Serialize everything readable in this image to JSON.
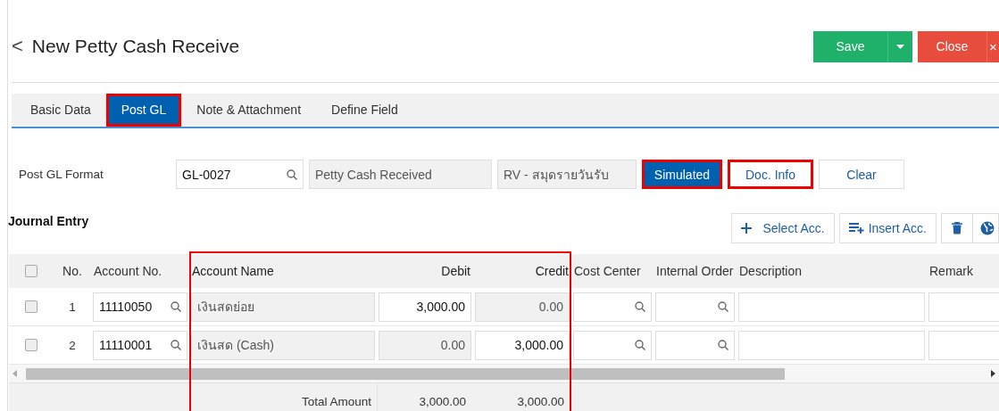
{
  "header": {
    "back": "<",
    "title": "New Petty Cash Receive",
    "save": "Save",
    "close": "Close",
    "close_x": "×"
  },
  "tabs": [
    {
      "label": "Basic Data",
      "selected": false,
      "highlighted": false
    },
    {
      "label": "Post GL",
      "selected": true,
      "highlighted": true
    },
    {
      "label": "Note & Attachment",
      "selected": false,
      "highlighted": false
    },
    {
      "label": "Define Field",
      "selected": false,
      "highlighted": false
    }
  ],
  "post_gl": {
    "label": "Post GL Format",
    "code": "GL-0027",
    "name": "Petty Cash Received",
    "journal": "RV - สมุดรายวันรับ",
    "buttons": [
      {
        "label": "Simulated",
        "kind": "primary",
        "highlighted": true
      },
      {
        "label": "Doc. Info",
        "kind": "default",
        "highlighted": true
      },
      {
        "label": "Clear",
        "kind": "default",
        "highlighted": false
      }
    ]
  },
  "journal": {
    "title": "Journal Entry",
    "select_acc": "Select Acc.",
    "insert_acc": "Insert Acc.",
    "select_all_checked": false,
    "columns": [
      {
        "label": "No.",
        "highlighted": false
      },
      {
        "label": "Account No.",
        "highlighted": false
      },
      {
        "label": "Account Name",
        "highlighted": true
      },
      {
        "label": "Debit",
        "highlighted": true
      },
      {
        "label": "Credit",
        "highlighted": true
      },
      {
        "label": "Cost Center",
        "highlighted": false
      },
      {
        "label": "Internal Order",
        "highlighted": false
      },
      {
        "label": "Description",
        "highlighted": false
      },
      {
        "label": "Remark",
        "highlighted": false
      }
    ],
    "rows": [
      {
        "checked": false,
        "no": "1",
        "account_no": "11110050",
        "account_name": "เงินสดย่อย",
        "debit": {
          "value": "3,000.00",
          "readonly": false
        },
        "credit": {
          "value": "0.00",
          "readonly": true
        }
      },
      {
        "checked": false,
        "no": "2",
        "account_no": "11110001",
        "account_name": "เงินสด (Cash)",
        "debit": {
          "value": "0.00",
          "readonly": true
        },
        "credit": {
          "value": "3,000.00",
          "readonly": false
        }
      }
    ],
    "total": {
      "label": "Total Amount",
      "debit": "3,000.00",
      "credit": "3,000.00"
    }
  }
}
